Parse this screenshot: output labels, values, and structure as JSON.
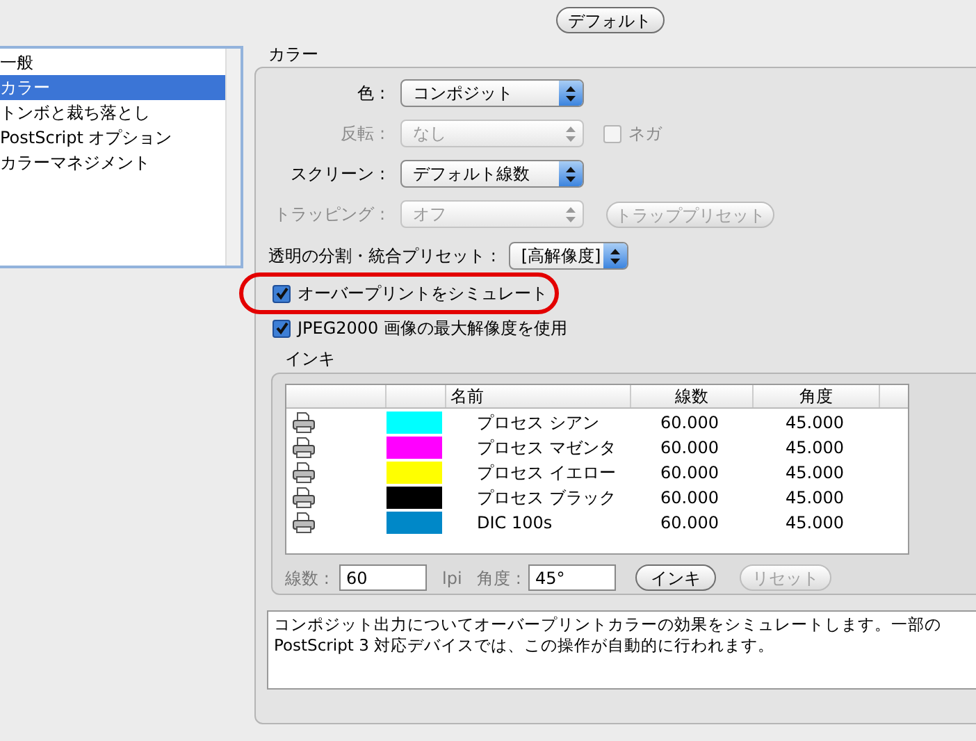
{
  "toolbar": {
    "default_button": "デフォルト"
  },
  "sidebar": {
    "items": [
      {
        "label": "一般",
        "selected": false
      },
      {
        "label": "カラー",
        "selected": true
      },
      {
        "label": "トンボと裁ち落とし",
        "selected": false
      },
      {
        "label": "PostScript オプション",
        "selected": false
      },
      {
        "label": "カラーマネジメント",
        "selected": false
      }
    ]
  },
  "color_panel": {
    "title": "カラー",
    "fields": [
      {
        "label": "色 :",
        "value": "コンポジット",
        "disabled": false
      },
      {
        "label": "反転 :",
        "value": "なし",
        "disabled": true,
        "checkbox": {
          "label": "ネガ",
          "checked": false,
          "disabled": true
        }
      },
      {
        "label": "スクリーン :",
        "value": "デフォルト線数",
        "disabled": false
      },
      {
        "label": "トラッピング :",
        "value": "オフ",
        "disabled": true,
        "button": {
          "label": "トラッププリセット",
          "disabled": true
        }
      }
    ],
    "flattener": {
      "label": "透明の分割・統合プリセット :",
      "value": "[高解像度]"
    },
    "checkboxes": [
      {
        "label": "オーバープリントをシミュレート",
        "checked": true,
        "highlighted": true
      },
      {
        "label": "JPEG2000 画像の最大解像度を使用",
        "checked": true,
        "highlighted": false
      }
    ],
    "inks": {
      "title": "インキ",
      "columns": [
        "名前",
        "線数",
        "角度"
      ],
      "rows": [
        {
          "name": "プロセス シアン",
          "color": "#00ffff",
          "frequency": "60.000",
          "angle": "45.000"
        },
        {
          "name": "プロセス マゼンタ",
          "color": "#ff00ff",
          "frequency": "60.000",
          "angle": "45.000"
        },
        {
          "name": "プロセス イエロー",
          "color": "#ffff00",
          "frequency": "60.000",
          "angle": "45.000"
        },
        {
          "name": "プロセス ブラック",
          "color": "#000000",
          "frequency": "60.000",
          "angle": "45.000"
        },
        {
          "name": "DIC 100s",
          "color": "#0088c8",
          "frequency": "60.000",
          "angle": "45.000"
        }
      ],
      "frequency": {
        "label": "線数 :",
        "value": "60",
        "unit": "lpi"
      },
      "angle": {
        "label": "角度 :",
        "value": "45°"
      },
      "buttons": [
        {
          "label": "インキ",
          "disabled": false
        },
        {
          "label": "リセット",
          "disabled": true
        }
      ]
    },
    "description": "コンポジット出力についてオーバープリントカラーの効果をシミュレートします。一部の PostScript 3 対応デバイスでは、この操作が自動的に行われます。"
  }
}
